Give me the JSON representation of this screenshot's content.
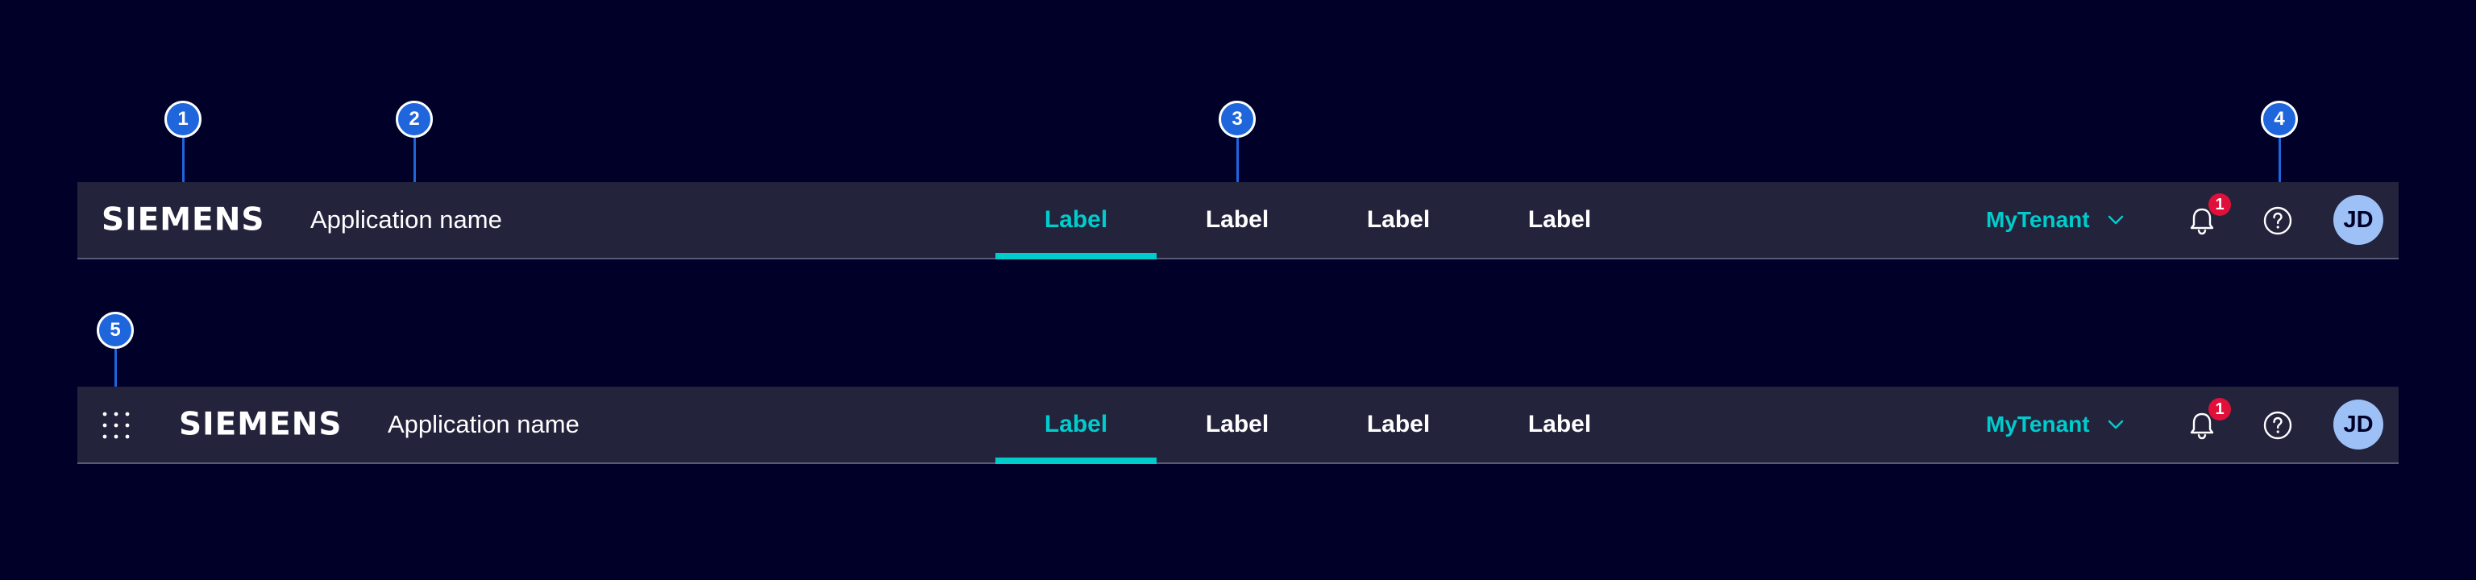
{
  "header_top": {
    "brand": "SIEMENS",
    "app_name": "Application name",
    "tabs": [
      "Label",
      "Label",
      "Label",
      "Label"
    ],
    "active_tab": 0,
    "tenant": "MyTenant",
    "notification_count": "1",
    "avatar_initials": "JD",
    "icons": [
      "chevron-down-icon",
      "bell-icon",
      "help-icon"
    ]
  },
  "header_bottom": {
    "brand": "SIEMENS",
    "app_name": "Application name",
    "tabs": [
      "Label",
      "Label",
      "Label",
      "Label"
    ],
    "active_tab": 0,
    "tenant": "MyTenant",
    "notification_count": "1",
    "avatar_initials": "JD",
    "icons": [
      "app-launcher-icon",
      "chevron-down-icon",
      "bell-icon",
      "help-icon"
    ]
  },
  "markers": [
    "1",
    "2",
    "3",
    "4",
    "5"
  ],
  "colors": {
    "background": "#000028",
    "navbar": "#23233c",
    "accent": "#00cccc",
    "marker": "#1f66dd",
    "badge": "#e0103a",
    "avatar": "#9dc1f7"
  }
}
